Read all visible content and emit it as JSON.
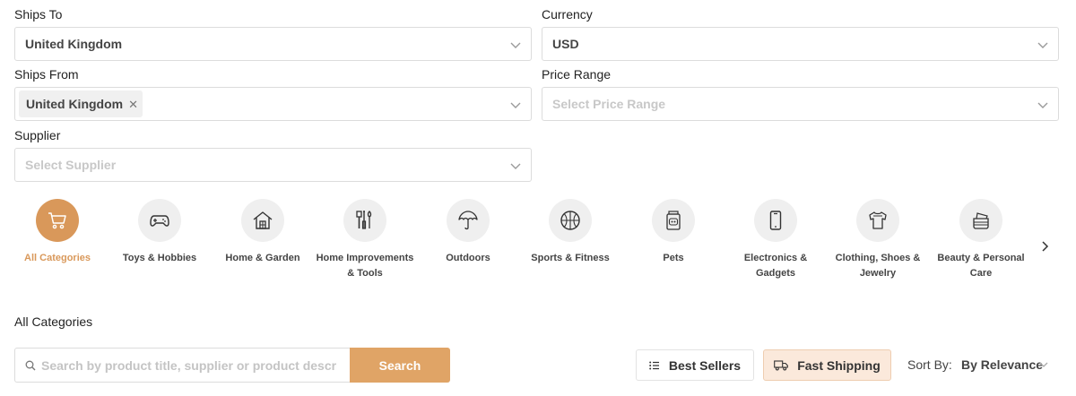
{
  "filters": {
    "ships_to": {
      "label": "Ships To",
      "value": "United Kingdom"
    },
    "currency": {
      "label": "Currency",
      "value": "USD"
    },
    "ships_from": {
      "label": "Ships From",
      "chip": "United Kingdom"
    },
    "price_range": {
      "label": "Price Range",
      "placeholder": "Select Price Range"
    },
    "supplier": {
      "label": "Supplier",
      "placeholder": "Select Supplier"
    }
  },
  "categories": [
    {
      "label": "All Categories",
      "icon": "cart-icon",
      "active": true
    },
    {
      "label": "Toys & Hobbies",
      "icon": "gamepad-icon"
    },
    {
      "label": "Home & Garden",
      "icon": "house-icon"
    },
    {
      "label": "Home Improvements & Tools",
      "icon": "tools-icon"
    },
    {
      "label": "Outdoors",
      "icon": "umbrella-icon"
    },
    {
      "label": "Sports & Fitness",
      "icon": "basketball-icon"
    },
    {
      "label": "Pets",
      "icon": "pet-food-icon"
    },
    {
      "label": "Electronics & Gadgets",
      "icon": "phone-icon"
    },
    {
      "label": "Clothing, Shoes & Jewelry",
      "icon": "shirt-icon"
    },
    {
      "label": "Beauty & Personal Care",
      "icon": "cosmetics-icon"
    }
  ],
  "section_title": "All Categories",
  "search": {
    "placeholder": "Search by product title, supplier or product descrip...",
    "button_label": "Search"
  },
  "toolbar": {
    "best_sellers_label": "Best Sellers",
    "fast_shipping_label": "Fast Shipping",
    "sort_label": "Sort By:",
    "sort_value": "By Relevance"
  },
  "colors": {
    "accent": "#d9985a",
    "accent_light": "#fbe9db"
  }
}
